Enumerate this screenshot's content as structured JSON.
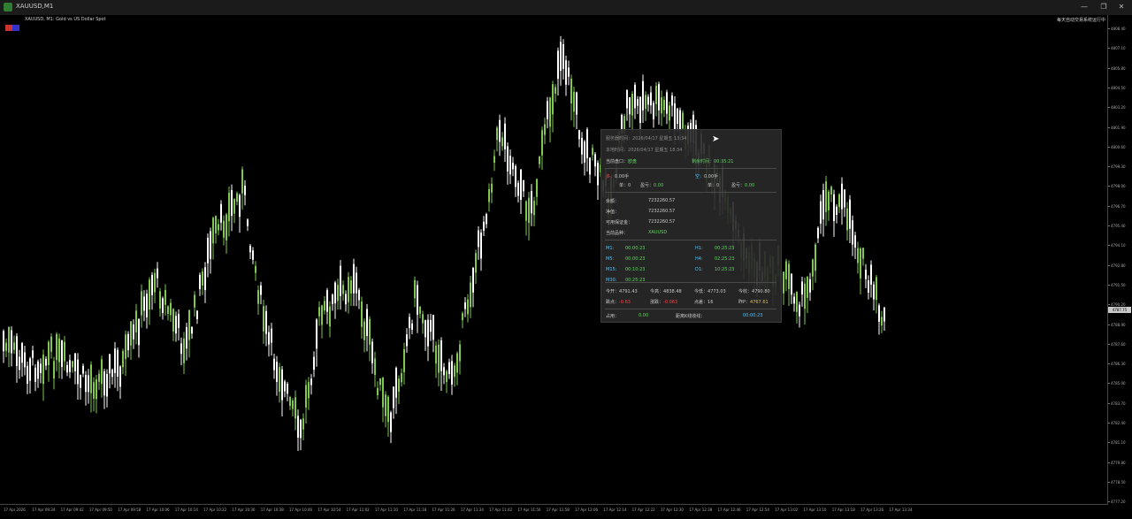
{
  "window": {
    "title": "XAUUSD,M1",
    "minimize": "—",
    "maximize": "❐",
    "close": "✕"
  },
  "chart": {
    "symbol_info": "XAUUSD, M1:  Gold vs US Dollar Spot",
    "top_right": "每天自动交易系统运行中",
    "bull_color": "#7ec850",
    "bear_color": "#ffffff",
    "current_price": "4787.75"
  },
  "price_axis": [
    "4808.40",
    "4807.10",
    "4805.80",
    "4804.50",
    "4803.20",
    "4801.90",
    "4800.60",
    "4799.30",
    "4798.00",
    "4796.70",
    "4795.40",
    "4794.10",
    "4792.80",
    "4791.50",
    "4790.20",
    "4788.90",
    "4787.60",
    "4786.30",
    "4785.00",
    "4783.70",
    "4782.40",
    "4781.10",
    "4779.80",
    "4778.50",
    "4777.20"
  ],
  "time_axis": [
    "17 Apr 2026",
    "17 Apr 09:34",
    "17 Apr 09:42",
    "17 Apr 09:50",
    "17 Apr 09:58",
    "17 Apr 10:06",
    "17 Apr 10:14",
    "17 Apr 10:22",
    "17 Apr 10:30",
    "17 Apr 10:38",
    "17 Apr 10:46",
    "17 Apr 10:54",
    "17 Apr 11:02",
    "17 Apr 11:10",
    "17 Apr 11:18",
    "17 Apr 11:26",
    "17 Apr 11:34",
    "17 Apr 11:42",
    "17 Apr 11:50",
    "17 Apr 11:58",
    "17 Apr 12:06",
    "17 Apr 12:14",
    "17 Apr 12:22",
    "17 Apr 12:30",
    "17 Apr 12:38",
    "17 Apr 12:46",
    "17 Apr 12:54",
    "17 Apr 13:02",
    "17 Apr 13:10",
    "17 Apr 13:18",
    "17 Apr 13:26",
    "17 Apr 13:34"
  ],
  "panel": {
    "server_time_label": "服务器时间：",
    "server_time": "2026/04/17 星期五 13:34",
    "local_time_label": "本地时间：",
    "local_time": "2026/04/17 星期五 18:34",
    "session_label": "当前盘口：",
    "session": "欧盘",
    "countdown_label": "剩余时间：",
    "countdown": "00:35:21",
    "buy_label": "多：",
    "buy_lots": "0.00手",
    "sell_label": "空：",
    "sell_lots": "0.00手",
    "buy_count_label": "单：",
    "buy_count": "0",
    "buy_profit_label": "盈亏：",
    "buy_profit": "0.00",
    "sell_count_label": "单：",
    "sell_count": "0",
    "sell_profit_label": "盈亏：",
    "sell_profit": "0.00",
    "balance_label": "余额：",
    "balance": "7232260.57",
    "equity_label": "净值：",
    "equity": "7232260.57",
    "free_margin_label": "可用保证金：",
    "free_margin": "7232260.57",
    "symbol_label": "当前品种：",
    "symbol": "XAUUSD",
    "timeframes": [
      {
        "label": "M1:",
        "value": "00:00:23"
      },
      {
        "label": "H1:",
        "value": "00:25:23"
      },
      {
        "label": "M5:",
        "value": "00:00:23"
      },
      {
        "label": "H4:",
        "value": "02:25:23"
      },
      {
        "label": "M15:",
        "value": "00:10:23"
      },
      {
        "label": "D1:",
        "value": "10:25:23"
      },
      {
        "label": "M30:",
        "value": "00:25:23"
      }
    ],
    "open_label": "今开：",
    "open": "4791.43",
    "high_label": "今高：",
    "high": "4838.48",
    "low_label": "今低：",
    "low": "4773.03",
    "close_label": "今收：",
    "close": "4790.80",
    "points_label": "跌点：",
    "points": "-0.63",
    "change_label": "涨跌：",
    "change": "-0.063",
    "spread_label": "点差：",
    "spread": "16",
    "prev_label": "昨P：",
    "prev": "4767.61",
    "swap_label": "占用：",
    "swap": "0.00",
    "next_bar_label": "距离K线收线：",
    "next_bar": "00:00:23"
  }
}
